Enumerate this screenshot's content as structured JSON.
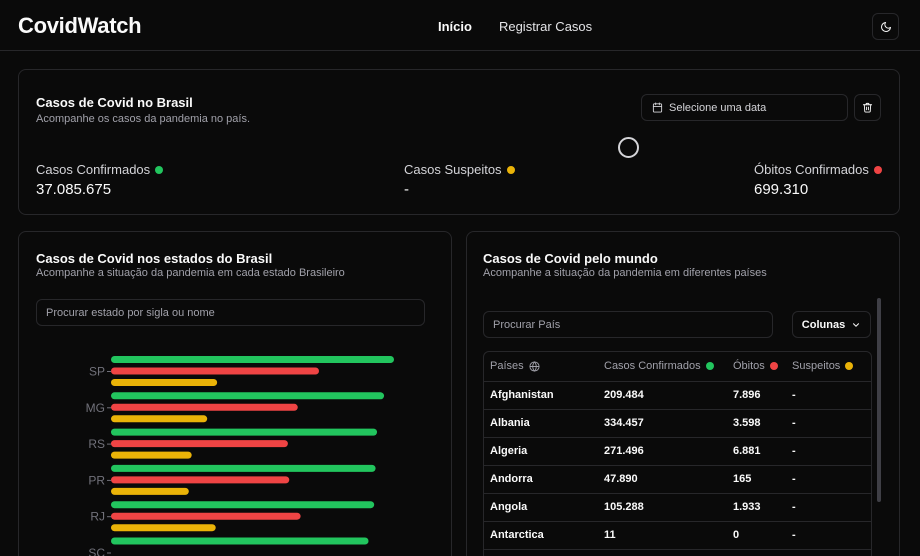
{
  "app": {
    "title": "CovidWatch"
  },
  "nav": {
    "items": [
      {
        "label": "Início"
      },
      {
        "label": "Registrar Casos"
      }
    ]
  },
  "colors": {
    "confirmed": "#22c55e",
    "deaths": "#ef4444",
    "suspected": "#eab308"
  },
  "brasil_card": {
    "title": "Casos de Covid no Brasil",
    "subtitle": "Acompanhe os casos da pandemia no país.",
    "date_placeholder": "Selecione uma data",
    "stats": [
      {
        "label": "Casos Confirmados",
        "value": "37.085.675",
        "color": "#22c55e"
      },
      {
        "label": "Casos Suspeitos",
        "value": "-",
        "color": "#eab308"
      },
      {
        "label": "Óbitos Confirmados",
        "value": "699.310",
        "color": "#ef4444"
      }
    ]
  },
  "states_card": {
    "title": "Casos de Covid nos estados do Brasil",
    "subtitle": "Acompanhe a situação da pandemia em cada estado Brasileiro",
    "search_placeholder": "Procurar estado por sigla ou nome"
  },
  "world_card": {
    "title": "Casos de Covid pelo mundo",
    "subtitle": "Acompanhe a situação da pandemia em diferentes países",
    "search_placeholder": "Procurar País",
    "columns_label": "Colunas",
    "headers": [
      "Países",
      "Casos Confirmados",
      "Óbitos",
      "Suspeitos"
    ],
    "rows": [
      [
        "Afghanistan",
        "209.484",
        "7.896",
        "-"
      ],
      [
        "Albania",
        "334.457",
        "3.598",
        "-"
      ],
      [
        "Algeria",
        "271.496",
        "6.881",
        "-"
      ],
      [
        "Andorra",
        "47.890",
        "165",
        "-"
      ],
      [
        "Angola",
        "105.288",
        "1.933",
        "-"
      ],
      [
        "Antarctica",
        "11",
        "0",
        "-"
      ],
      [
        "",
        "",
        "",
        ""
      ]
    ]
  },
  "chart_data": {
    "type": "bar",
    "orientation": "horizontal",
    "categories": [
      "SP",
      "MG",
      "RS",
      "PR",
      "RJ",
      "SC"
    ],
    "series": [
      {
        "values": [
          100,
          96.5,
          94,
          93.5,
          93,
          91
        ],
        "color": "#22c55e"
      },
      {
        "values": [
          73.5,
          66,
          62.5,
          63,
          67,
          0
        ],
        "color": "#ef4444"
      },
      {
        "values": [
          37.5,
          34,
          28.5,
          27.5,
          37,
          0
        ],
        "color": "#eab308"
      }
    ]
  }
}
